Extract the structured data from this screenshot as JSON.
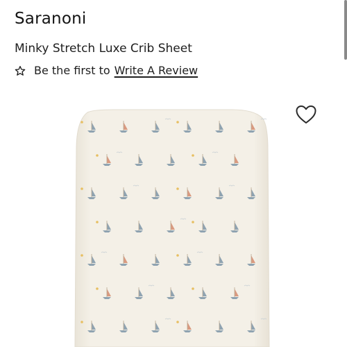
{
  "product": {
    "brand": "Saranoni",
    "title": "Minky Stretch Luxe Crib Sheet"
  },
  "reviews": {
    "prefix": "Be the first to",
    "link_label": "Write A Review",
    "star_icon": "star-outline-icon"
  },
  "gallery": {
    "wishlist_icon": "heart-outline-icon",
    "image_subject": "crib sheet with sailboat pattern"
  },
  "colors": {
    "sheet": "#f3efe6",
    "sail_gray": "#8fa3b1",
    "sail_coral": "#d99a80",
    "sun_yellow": "#e7bf62",
    "text": "#1a1a1a"
  }
}
